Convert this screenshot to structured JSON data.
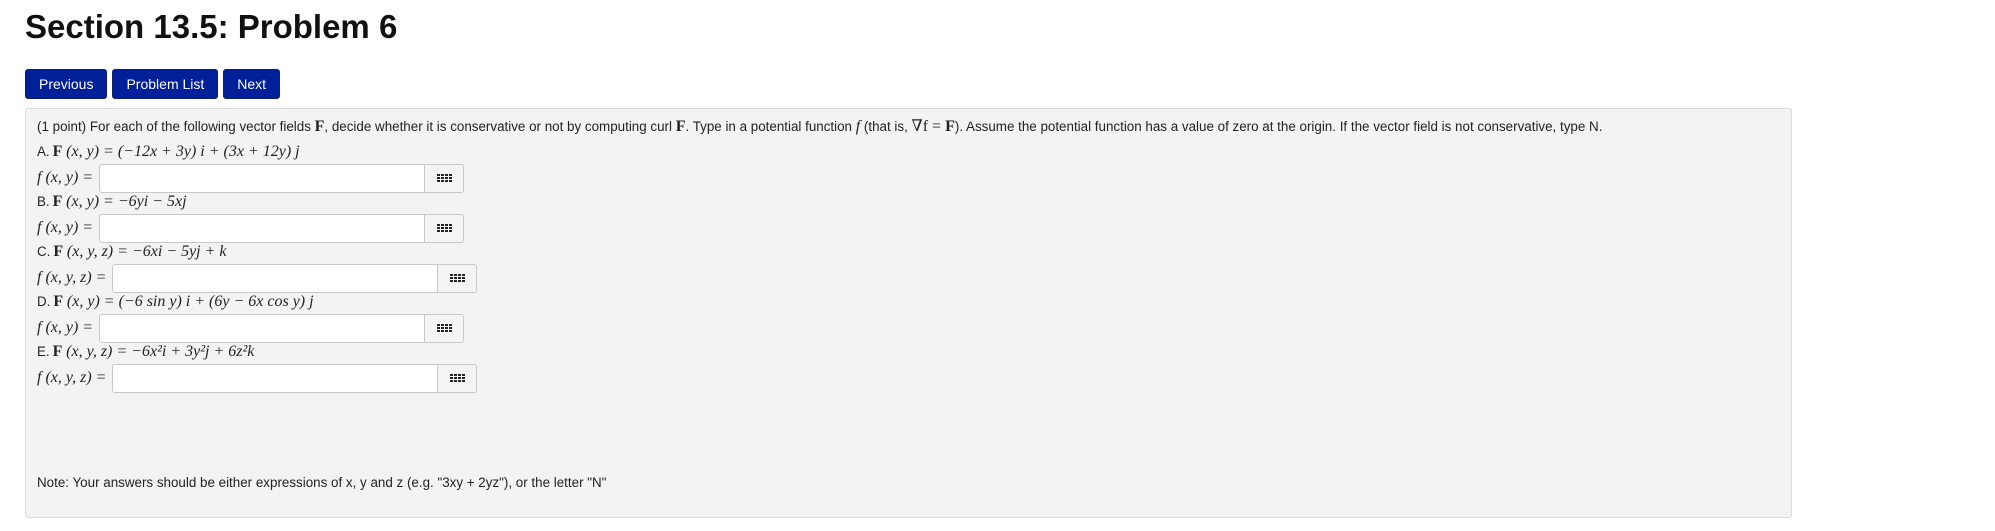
{
  "title": "Section 13.5: Problem 6",
  "nav": {
    "previous": "Previous",
    "problem_list": "Problem List",
    "next": "Next"
  },
  "intro": {
    "p1": "(1 point) For each of the following vector fields ",
    "F1": "F",
    "p2": ", decide whether it is conservative or not by computing curl ",
    "F2": "F",
    "p3": ". Type in a potential function ",
    "f": "f",
    "p4": " (that is, ",
    "nabla": "∇f = ",
    "F3": "F",
    "p5": "). Assume the potential function has a value of zero at the origin. If the vector field is not conservative, type N."
  },
  "parts": [
    {
      "letter": "A.",
      "field_lhs": "F",
      "field_args": "(x, y) = ",
      "field_rhs": "(−12x + 3y) i + (3x + 12y) j",
      "answer_label": "f (x, y) =",
      "answer_value": ""
    },
    {
      "letter": "B.",
      "field_lhs": "F",
      "field_args": "(x, y) = ",
      "field_rhs": "−6yi − 5xj",
      "answer_label": "f (x, y) =",
      "answer_value": ""
    },
    {
      "letter": "C.",
      "field_lhs": "F",
      "field_args": "(x, y, z) = ",
      "field_rhs": "−6xi − 5yj + k",
      "answer_label": "f (x, y, z) =",
      "answer_value": ""
    },
    {
      "letter": "D.",
      "field_lhs": "F",
      "field_args": "(x, y) = ",
      "field_rhs": "(−6 sin y) i + (6y − 6x cos y) j",
      "answer_label": "f (x, y) =",
      "answer_value": ""
    },
    {
      "letter": "E.",
      "field_lhs": "F",
      "field_args": "(x, y, z) = ",
      "field_rhs": "−6x²i + 3y²j + 6z²k",
      "answer_label": "f (x, y, z) =",
      "answer_value": ""
    }
  ],
  "note": "Note: Your answers should be either expressions of x, y and z (e.g. \"3xy + 2yz\"), or the letter \"N\"",
  "colors": {
    "nav_button_bg": "#00209a",
    "panel_bg": "#f3f3f3"
  },
  "icons": {
    "answer_tool": "keyboard-grid-icon"
  }
}
